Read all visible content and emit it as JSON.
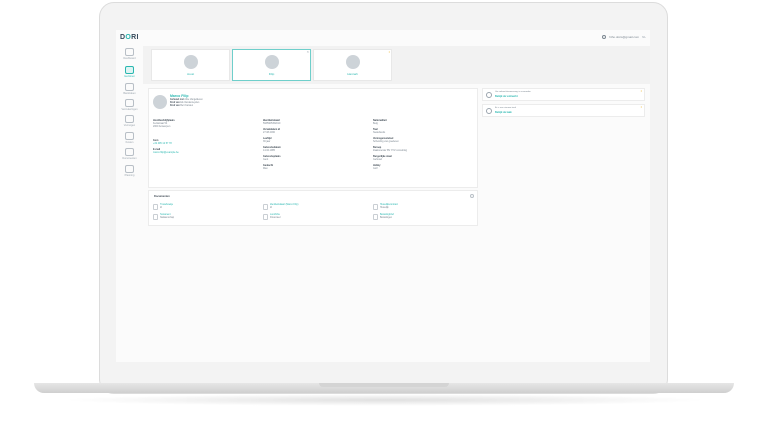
{
  "app": {
    "logo_part1": "D",
    "logo_part2": "O",
    "logo_part3": "RI"
  },
  "topbar": {
    "user_label": "htho.doris@gmail.com",
    "language": "NL"
  },
  "sidebar": {
    "items": [
      {
        "label": "Dashboard",
        "icon": "dashboard-icon",
        "active": false
      },
      {
        "label": "Gezinnen",
        "icon": "family-icon",
        "active": true
      },
      {
        "label": "Bankzaken",
        "icon": "bank-icon",
        "active": false
      },
      {
        "label": "Verzekeringen",
        "icon": "insurance-icon",
        "active": false
      },
      {
        "label": "Vermogen",
        "icon": "assets-icon",
        "active": false
      },
      {
        "label": "Kosten",
        "icon": "costs-icon",
        "active": false
      },
      {
        "label": "Documenten",
        "icon": "documents-icon",
        "active": false
      },
      {
        "label": "Planning",
        "icon": "planning-icon",
        "active": false
      }
    ]
  },
  "members": [
    {
      "name": "Joost",
      "active": false
    },
    {
      "name": "Filip",
      "active": true
    },
    {
      "name": "Hannah",
      "active": false
    }
  ],
  "profile": {
    "name": "Marco Filip",
    "lines": [
      {
        "key": "Gehuwd met",
        "value": "Alice Vangelderen"
      },
      {
        "key": "Kind van",
        "value": "Els Vanderweyden"
      },
      {
        "key": "Kind van",
        "value": "Bert Karsten"
      }
    ],
    "fields": [
      {
        "label": "Hoofdverblijfplaats",
        "lines": [
          "Kerkstraat 54",
          "2000 Antwerpen"
        ],
        "link": false
      },
      {
        "label": "Gsm",
        "lines": [
          "+32 495 12 57 78"
        ],
        "link": true
      },
      {
        "label": "E-mail",
        "lines": [
          "marco.filip@example.be"
        ],
        "link": true
      },
      {
        "label": "Identiteitskaart",
        "lines": [
          "5935905452010"
        ],
        "link": false
      },
      {
        "label": "Vervaldatum id",
        "lines": [
          "27.08.2030"
        ],
        "link": false
      },
      {
        "label": "Leeftijd",
        "lines": [
          "36 jaar"
        ],
        "link": false
      },
      {
        "label": "Geboortedatum",
        "lines": [
          "14.02.1985"
        ],
        "link": false
      },
      {
        "label": "Geboorteplaats",
        "lines": [
          "Gent"
        ],
        "link": false
      },
      {
        "label": "Geslacht",
        "lines": [
          "Man"
        ],
        "link": false
      },
      {
        "label": "Nationaliteit",
        "lines": [
          "Belg"
        ],
        "link": false
      },
      {
        "label": "Taal",
        "lines": [
          "Nederlands"
        ],
        "link": false
      },
      {
        "label": "Vermogensstelsel",
        "lines": [
          "Scheiding van goederen"
        ],
        "link": false
      },
      {
        "label": "Beroep",
        "lines": [
          "Zaakvoerder BV XYZ consulting"
        ],
        "link": false
      },
      {
        "label": "Burgerlijke staat",
        "lines": [
          "Gehuwd"
        ],
        "link": false
      },
      {
        "label": "Hobby",
        "lines": [
          "Golf"
        ],
        "link": false
      }
    ]
  },
  "documents": {
    "title": "Documenten",
    "items": [
      {
        "title": "Trouwboekje",
        "sub": "Id"
      },
      {
        "title": "Identiteitskaart (Marco Filip)",
        "sub": "Id"
      },
      {
        "title": "Huwelijkscontract",
        "sub": "Huwelijk"
      },
      {
        "title": "Testament",
        "sub": "Nalatenschap"
      },
      {
        "title": "Loonfiche",
        "sub": "Financieel"
      },
      {
        "title": "Belastingbrief",
        "sub": "Belastingen"
      }
    ]
  },
  "notices": [
    {
      "small": "Uw volmachtsaanvraag is verzonden",
      "link": "Bekijk de volmacht"
    },
    {
      "small": "Er is een nieuwe taak",
      "link": "Bekijk de taak"
    }
  ],
  "colors": {
    "accent": "#29b7b0",
    "text": "#3d4852",
    "muted": "#7b8690",
    "notice_dot": "#f0c24b"
  }
}
